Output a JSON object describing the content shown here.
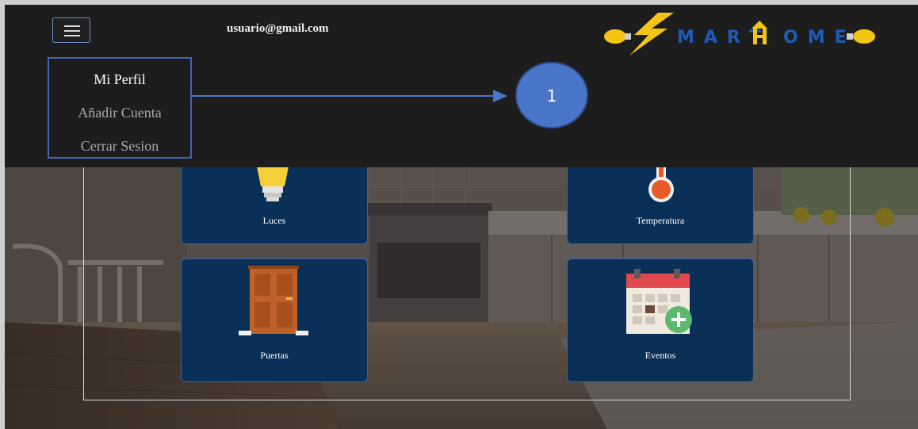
{
  "header": {
    "user_email": "usuario@gmail.com",
    "logo_text": "MART",
    "logo_text_2": "OME"
  },
  "menu": {
    "items": [
      {
        "label": "Mi Perfil",
        "active": true
      },
      {
        "label": "Añadir Cuenta",
        "active": false
      },
      {
        "label": "Cerrar Sesion",
        "active": false
      }
    ]
  },
  "annotation": {
    "number": "1"
  },
  "cards": [
    {
      "label": "Luces",
      "icon": "lightbulb-icon"
    },
    {
      "label": "Temperatura",
      "icon": "thermometer-icon"
    },
    {
      "label": "Puertas",
      "icon": "door-icon"
    },
    {
      "label": "Eventos",
      "icon": "calendar-add-icon"
    }
  ],
  "colors": {
    "topbar": "#1d1d1d",
    "card_bg": "#0b3058",
    "card_border": "#2f64b6",
    "menu_border": "#3f67b7",
    "callout": "#4a76c9",
    "logo_yellow": "#f4c414",
    "logo_blue": "#1e5bb8"
  }
}
